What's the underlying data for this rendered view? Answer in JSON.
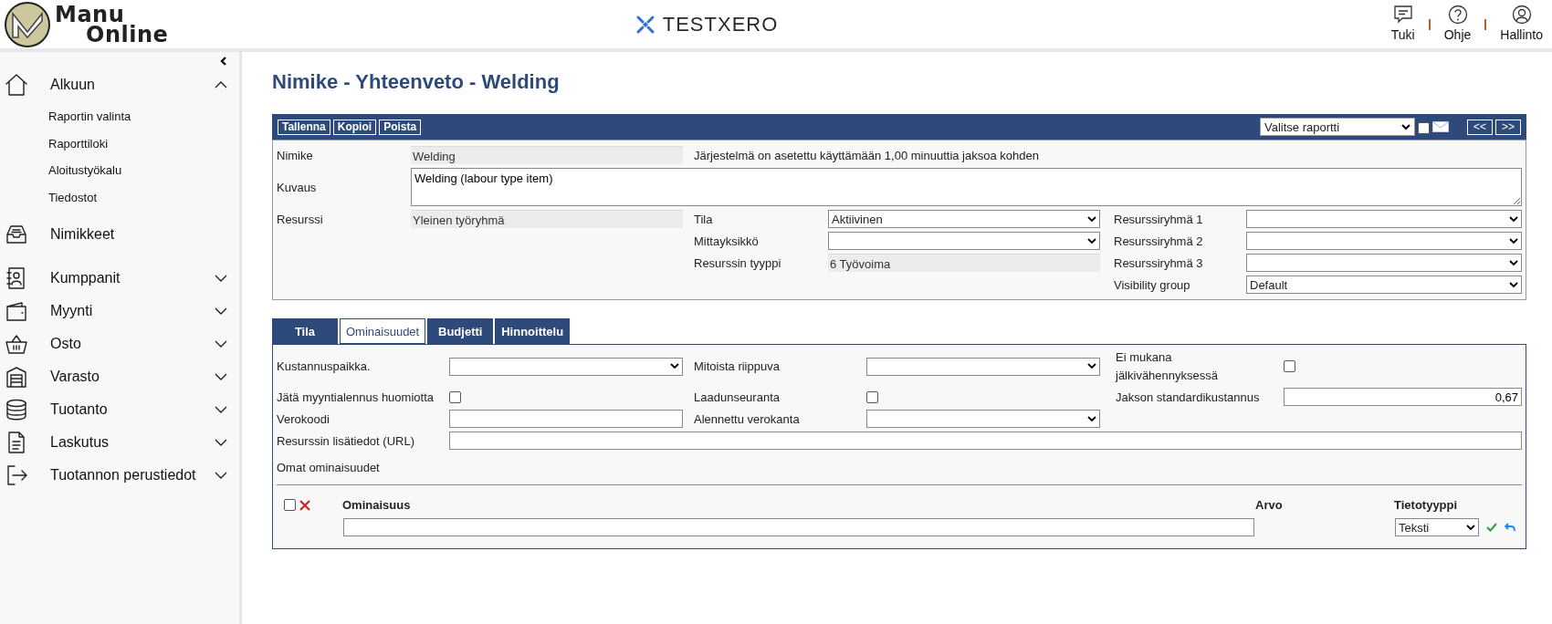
{
  "header": {
    "logo": {
      "line1": "Manu",
      "line2": "Online"
    },
    "brand": "TESTXERO",
    "actions": [
      {
        "kind": "chat",
        "label": "Tuki"
      },
      {
        "kind": "help",
        "label": "Ohje"
      },
      {
        "kind": "user",
        "label": "Hallinto"
      }
    ]
  },
  "sidebar": {
    "items": [
      {
        "label": "Alkuun",
        "expanded": true,
        "children": [
          {
            "label": "Raportin valinta"
          },
          {
            "label": "Raporttiloki"
          },
          {
            "label": "Aloitustyökalu"
          },
          {
            "label": "Tiedostot"
          }
        ]
      },
      {
        "label": "Nimikkeet"
      },
      {
        "label": "Kumppanit",
        "expanded": false
      },
      {
        "label": "Myynti",
        "expanded": false
      },
      {
        "label": "Osto",
        "expanded": false
      },
      {
        "label": "Varasto",
        "expanded": false
      },
      {
        "label": "Tuotanto",
        "expanded": false
      },
      {
        "label": "Laskutus",
        "expanded": false
      },
      {
        "label": "Tuotannon perustiedot",
        "expanded": false
      }
    ]
  },
  "page_title": "Nimike - Yhteenveto - Welding",
  "toolbar": {
    "buttons": [
      "Tallenna",
      "Kopioi",
      "Poista"
    ],
    "report_select": {
      "value": "Valitse raportti"
    },
    "email_checkbox": {
      "checked": false
    },
    "nav_buttons": [
      "<<",
      ">>"
    ]
  },
  "summary": {
    "nimike": {
      "label": "Nimike",
      "value": "Welding"
    },
    "note": "Järjestelmä on asetettu käyttämään 1,00 minuuttia jaksoa kohden",
    "kuvaus": {
      "label": "Kuvaus",
      "value": "Welding (labour type item)"
    },
    "resurssi": {
      "label": "Resurssi",
      "value": "Yleinen työryhmä"
    },
    "middle_fields": [
      {
        "label": "Tila",
        "kind": "select",
        "value": "Aktiivinen"
      },
      {
        "label": "Mittayksikkö",
        "kind": "select"
      },
      {
        "label": "Resurssin tyyppi",
        "kind": "readonly",
        "value": "6 Työvoima"
      }
    ],
    "right_fields": [
      {
        "label": "Resurssiryhmä 1",
        "kind": "select"
      },
      {
        "label": "Resurssiryhmä 2",
        "kind": "select"
      },
      {
        "label": "Resurssiryhmä 3",
        "kind": "select"
      },
      {
        "label": "Visibility group",
        "kind": "select",
        "value": "Default"
      }
    ]
  },
  "tabs": [
    {
      "label": "Tila",
      "selected": false
    },
    {
      "label": "Ominaisuudet",
      "selected": true
    },
    {
      "label": "Budjetti",
      "selected": false
    },
    {
      "label": "Hinnoittelu",
      "selected": false
    }
  ],
  "properties": {
    "rows": [
      [
        {
          "label": "Kustannuspaikka.",
          "kind": "select"
        },
        {
          "label": "Mitoista riippuva",
          "kind": "select"
        },
        {
          "label": "Ei mukana jälkivähennyksessä",
          "kind": "checkbox",
          "checked": false
        }
      ],
      [
        {
          "label": "Jätä myyntialennus huomiotta",
          "kind": "checkbox",
          "checked": false
        },
        {
          "label": "Laadunseuranta",
          "kind": "checkbox",
          "checked": false
        },
        {
          "label": "Jakson standardikustannus",
          "kind": "number",
          "value": "0,67"
        }
      ],
      [
        {
          "label": "Verokoodi",
          "kind": "input"
        },
        {
          "label": "Alennettu verokanta",
          "kind": "select"
        }
      ],
      [
        {
          "label": "Resurssin lisätiedot (URL)",
          "kind": "wide_input"
        }
      ]
    ],
    "section_label": "Omat ominaisuudet",
    "table": {
      "select_all": {
        "checked": false
      },
      "columns": [
        "Ominaisuus",
        "Arvo",
        "Tietotyyppi"
      ],
      "new_row": {
        "type_select": {
          "value": "Teksti"
        }
      }
    }
  }
}
